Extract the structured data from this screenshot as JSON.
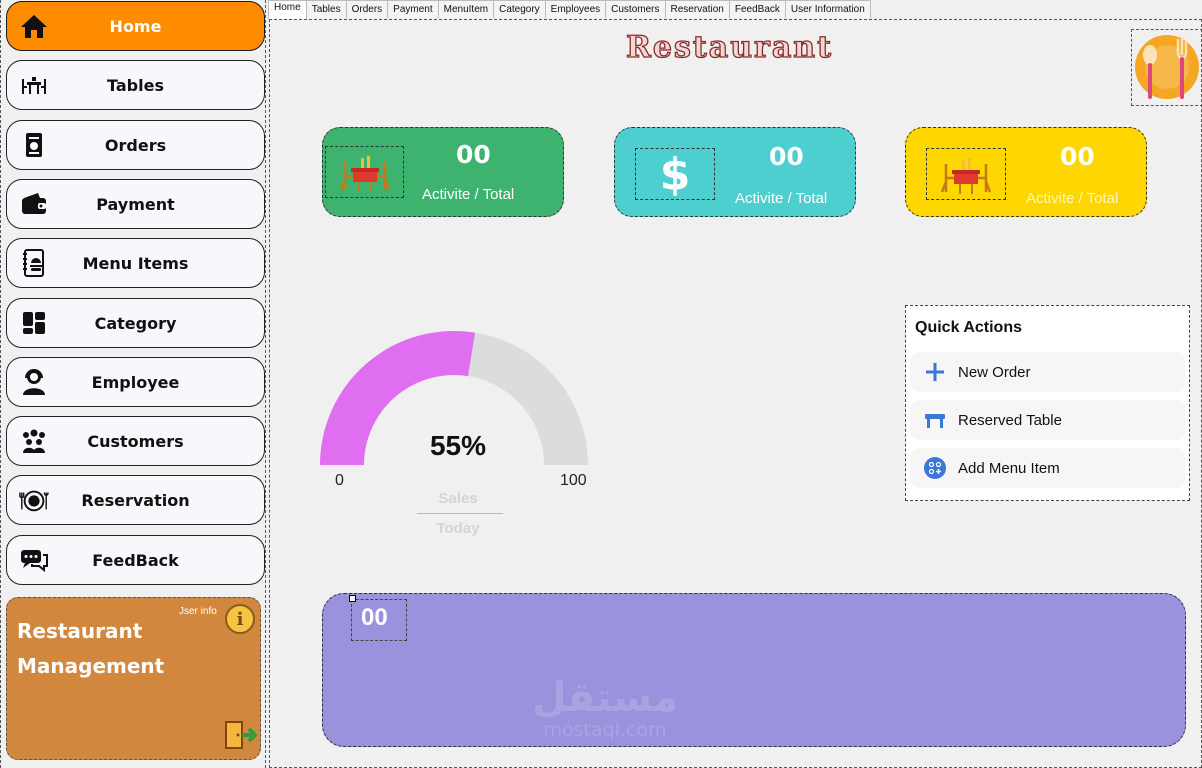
{
  "sidebar": {
    "items": [
      {
        "label": "Home",
        "icon": "home-icon"
      },
      {
        "label": "Tables",
        "icon": "table-icon"
      },
      {
        "label": "Orders",
        "icon": "orders-icon"
      },
      {
        "label": "Payment",
        "icon": "wallet-icon"
      },
      {
        "label": "Menu Items",
        "icon": "menu-book-icon"
      },
      {
        "label": "Category",
        "icon": "category-icon"
      },
      {
        "label": "Employee",
        "icon": "employee-icon"
      },
      {
        "label": "Customers",
        "icon": "customers-icon"
      },
      {
        "label": "Reservation",
        "icon": "reservation-icon"
      },
      {
        "label": "FeedBack",
        "icon": "feedback-icon"
      }
    ],
    "active_index": 0,
    "user_card": {
      "title": "Restaurant Management",
      "info_label": "Jser info",
      "info_icon": "info-icon",
      "exit_icon": "exit-door-icon"
    }
  },
  "tabs": [
    "Home",
    "Tables",
    "Orders",
    "Payment",
    "MenuItem",
    "Category",
    "Employees",
    "Customers",
    "Reservation",
    "FeedBack",
    "User Information"
  ],
  "main": {
    "title": "Restaurant",
    "stat_cards": [
      {
        "value": "00",
        "label": "Activite / Total",
        "color": "#3db36f",
        "icon": "dining-table-icon"
      },
      {
        "value": "00",
        "label": "Activite / Total",
        "color": "#4ecfcf",
        "icon": "dollar-icon"
      },
      {
        "value": "00",
        "label": "Activite / Total",
        "color": "#ffd600",
        "icon": "dining-table-icon"
      }
    ],
    "gauge": {
      "percent_label": "55%",
      "value": 55,
      "min": "0",
      "max": "100",
      "label_top": "Sales",
      "label_bottom": "Today",
      "fill_color": "#e06ef0",
      "track_color": "#dcdcdc"
    },
    "quick_actions": {
      "title": "Quick Actions",
      "items": [
        {
          "label": "New Order",
          "icon": "plus-icon"
        },
        {
          "label": "Reserved Table",
          "icon": "table-icon"
        },
        {
          "label": "Add Menu Item",
          "icon": "add-item-icon"
        }
      ]
    },
    "bottom_panel": {
      "value": "00",
      "color": "#9b92dd",
      "watermark_ar": "مستقل",
      "watermark_en": "mostaql.com"
    }
  }
}
